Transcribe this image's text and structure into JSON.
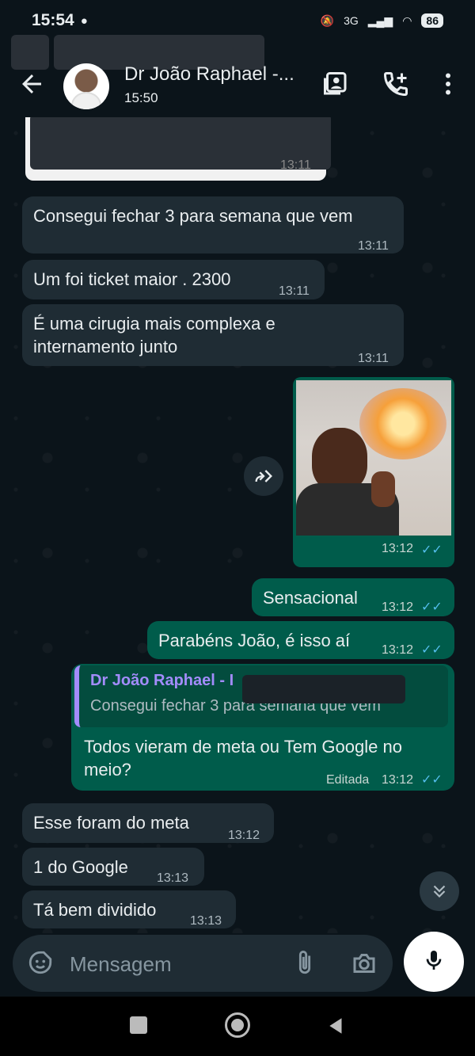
{
  "status_bar": {
    "time": "15:54",
    "network": "3G",
    "battery": "86"
  },
  "header": {
    "contact_name": "Dr João Raphael -...",
    "last_seen": "15:50"
  },
  "messages": [
    {
      "type": "in",
      "text": "Consegui fechar 3 para semana que vem",
      "time": "13:11"
    },
    {
      "type": "in",
      "text": "Um foi ticket maior . 2300",
      "time": "13:11"
    },
    {
      "type": "in",
      "text": "É uma cirugia mais complexa e internamento junto",
      "time": "13:11"
    },
    {
      "type": "out-image",
      "time": "13:12"
    },
    {
      "type": "out",
      "text": "Sensacional",
      "time": "13:12"
    },
    {
      "type": "out",
      "text": "Parabéns João, é isso aí",
      "time": "13:12"
    },
    {
      "type": "out-reply",
      "quote_author": "Dr João Raphael - I",
      "quote_text": "Consegui fechar 3 para semana que vem",
      "text": "Todos vieram de meta ou Tem Google no meio?",
      "edited_label": "Editada",
      "time": "13:12"
    },
    {
      "type": "in",
      "text": "Esse foram do meta",
      "time": "13:12"
    },
    {
      "type": "in",
      "text": "1 do Google",
      "time": "13:13"
    },
    {
      "type": "in",
      "text": "Tá bem dividido",
      "time": "13:13"
    }
  ],
  "top_partial_time": "13:11",
  "ticks_glyph": "✓✓",
  "input": {
    "placeholder": "Mensagem"
  },
  "colors": {
    "background": "#0b141a",
    "incoming": "#1f2c34",
    "outgoing": "#005c4b",
    "read_ticks": "#53bdeb",
    "quote_bar": "#a38cfc"
  }
}
